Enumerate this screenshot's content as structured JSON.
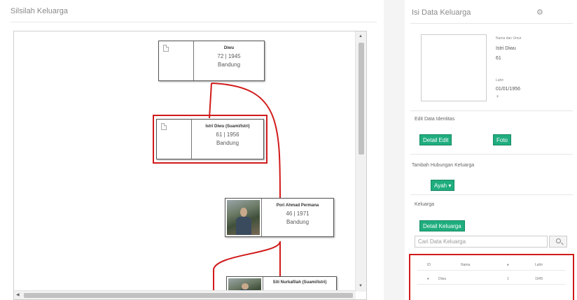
{
  "left": {
    "title": "Silsilah Keluarga",
    "tree": [
      {
        "name": "Diwu",
        "year": "72 | 1945",
        "place": "Bandung"
      },
      {
        "name": "Istri Diwu (Suami/Istri)",
        "year": "61 | 1956",
        "place": "Bandung"
      },
      {
        "name": "Pori Ahmad Permana",
        "year": "46 | 1971",
        "place": "Bandung"
      },
      {
        "name": "Siti Nurkafilah (Suami/Istri)"
      }
    ]
  },
  "right": {
    "title": "Isi Data Keluarga",
    "gear_icon": "gear-icon",
    "profile": {
      "name_label": "Nama dan Umur",
      "name_value": "Istri Diwu",
      "age_value": "61",
      "birth_label": "Lahir",
      "birth_value": "01/01/1956",
      "gender_value": "♀"
    },
    "identity_label": "Edit Data Identitas",
    "edit_button": "Detail Edit",
    "photo_button": "Foto",
    "relation_label": "Tambah Hubungan Keluarga",
    "add_button": "Ayah ▾",
    "family_label": "Keluarga",
    "family_button": "Detail Keluarga",
    "search_placeholder": "Cari Data Keluarga",
    "table_headers": [
      "ID",
      "Nama",
      "♦",
      "Lahir"
    ],
    "table_rows": [
      [
        "♦",
        "Diwu",
        "1",
        "1945"
      ]
    ]
  },
  "colors": {
    "accent": "#1fad7e",
    "highlight": "#d11a1a",
    "line": "#d11a1a"
  }
}
